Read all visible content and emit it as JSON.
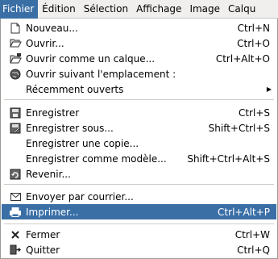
{
  "menubar": {
    "items": [
      {
        "label": "Fichier",
        "active": true
      },
      {
        "label": "Édition"
      },
      {
        "label": "Sélection"
      },
      {
        "label": "Affichage"
      },
      {
        "label": "Image"
      },
      {
        "label": "Calqu"
      }
    ]
  },
  "file_menu": {
    "items": [
      {
        "icon": "new-document-icon",
        "label": "Nouveau...",
        "accel": "Ctrl+N"
      },
      {
        "icon": "open-folder-icon",
        "label": "Ouvrir...",
        "accel": "Ctrl+O"
      },
      {
        "icon": "open-as-layers-icon",
        "label": "Ouvrir comme un calque...",
        "accel": "Ctrl+Alt+O"
      },
      {
        "icon": "open-location-icon",
        "label": "Ouvrir suivant l'emplacement :",
        "accel": ""
      },
      {
        "icon": "",
        "label": "Récemment ouverts",
        "accel": "",
        "submenu": true
      },
      {
        "icon": "save-icon",
        "label": "Enregistrer",
        "accel": "Ctrl+S"
      },
      {
        "icon": "save-as-icon",
        "label": "Enregistrer sous...",
        "accel": "Shift+Ctrl+S"
      },
      {
        "icon": "",
        "label": "Enregistrer une copie...",
        "accel": ""
      },
      {
        "icon": "",
        "label": "Enregistrer comme modèle...",
        "accel": "Shift+Ctrl+Alt+S"
      },
      {
        "icon": "revert-icon",
        "label": "Revenir...",
        "accel": ""
      },
      {
        "icon": "mail-icon",
        "label": "Envoyer par courrier...",
        "accel": ""
      },
      {
        "icon": "print-icon",
        "label": "Imprimer...",
        "accel": "Ctrl+Alt+P",
        "highlighted": true
      },
      {
        "icon": "close-icon",
        "label": "Fermer",
        "accel": "Ctrl+W"
      },
      {
        "icon": "quit-icon",
        "label": "Quitter",
        "accel": "Ctrl+Q"
      }
    ]
  },
  "colors": {
    "highlight": "#3a6fa6",
    "menubar_bg": "#f0efee"
  }
}
